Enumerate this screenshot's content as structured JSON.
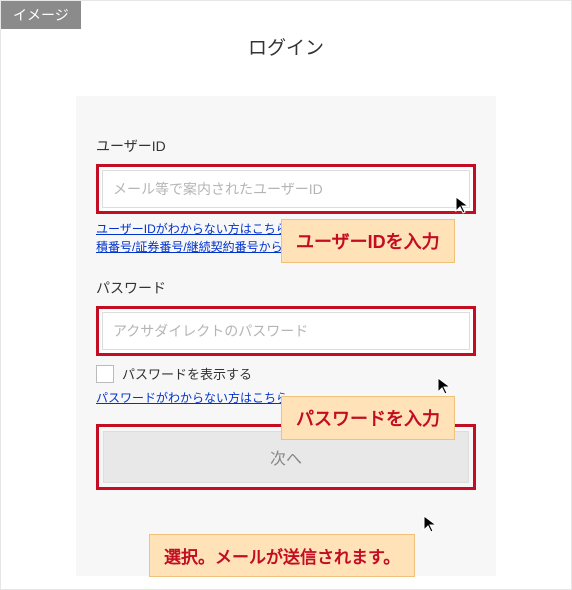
{
  "badge": "イメージ",
  "title": "ログイン",
  "userId": {
    "label": "ユーザーID",
    "placeholder": "メール等で案内されたユーザーID",
    "help": "ユーザーIDがわからない方はこちら（見積番号/証券番号/継続契約番号から）"
  },
  "password": {
    "label": "パスワード",
    "placeholder": "アクサダイレクトのパスワード",
    "showLabel": "パスワードを表示する",
    "help": "パスワードがわからない方はこちら"
  },
  "nextButton": "次へ",
  "callouts": {
    "userId": "ユーザーIDを入力",
    "password": "パスワードを入力",
    "submit": "選択。メールが送信されます。"
  },
  "colors": {
    "highlight": "#c30d23",
    "link": "#0033cc",
    "calloutBg": "#ffe2b8",
    "badgeBg": "#8b8b8b"
  }
}
